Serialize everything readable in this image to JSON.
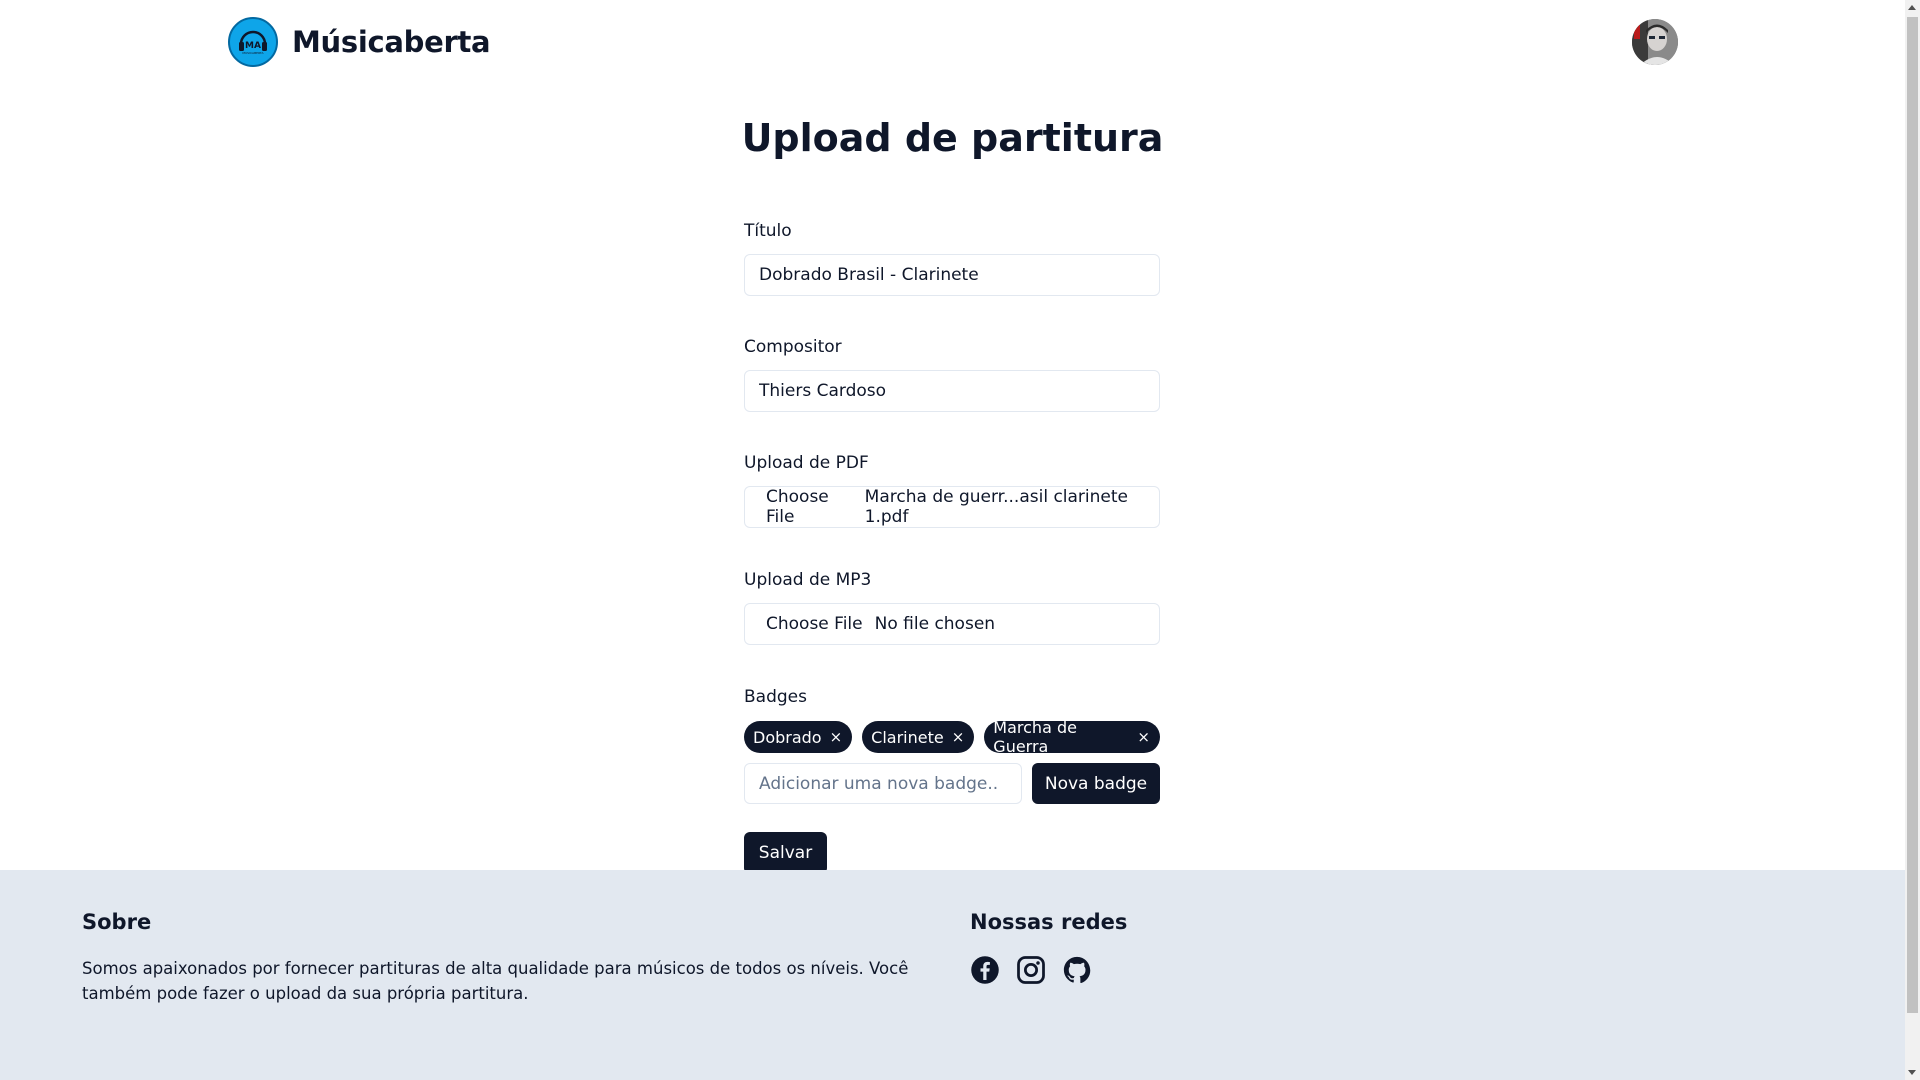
{
  "header": {
    "brand_name": "Músicaberta",
    "logo_text": "MA",
    "logo_subtext": "MUSICABERTA"
  },
  "main": {
    "title": "Upload de partitura",
    "fields": {
      "titulo": {
        "label": "Título",
        "value": "Dobrado Brasil - Clarinete"
      },
      "compositor": {
        "label": "Compositor",
        "value": "Thiers Cardoso"
      },
      "pdf": {
        "label": "Upload de PDF",
        "button": "Choose File",
        "file": "Marcha de guerr...asil clarinete 1.pdf"
      },
      "mp3": {
        "label": "Upload de MP3",
        "button": "Choose File",
        "file": "No file chosen"
      }
    },
    "badges": {
      "label": "Badges",
      "items": [
        "Dobrado",
        "Clarinete",
        "Marcha de Guerra"
      ],
      "remove_symbol": "×",
      "input_placeholder": "Adicionar uma nova badge..",
      "add_button": "Nova badge"
    },
    "save_button": "Salvar"
  },
  "footer": {
    "about_title": "Sobre",
    "about_text": "Somos apaixonados por fornecer partituras de alta qualidade para músicos de todos os níveis. Você também pode fazer o upload da sua própria partitura.",
    "social_title": "Nossas redes",
    "social_icons": [
      "facebook-icon",
      "instagram-icon",
      "github-icon"
    ]
  },
  "colors": {
    "primary_dark": "#0f172a",
    "footer_bg": "#e2e8f0",
    "logo_blue": "#0ea5e9",
    "input_border": "#e2e8f0"
  }
}
